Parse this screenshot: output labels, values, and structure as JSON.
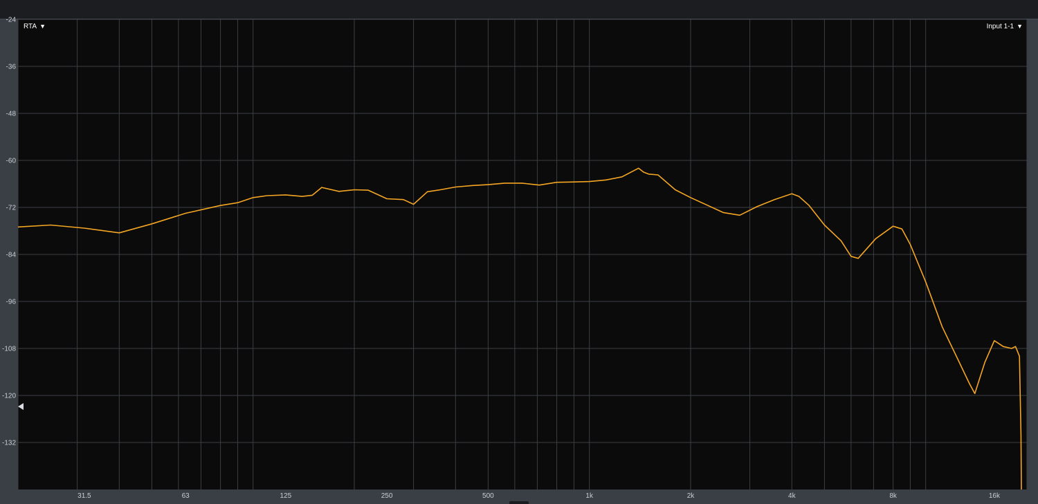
{
  "toolbar": {
    "analyzer_mode": "RTA",
    "input_source": "Input 1-1",
    "caret": "▼"
  },
  "icons": {
    "mode_dropdown": "chevron-down-icon",
    "input_dropdown": "chevron-down-icon",
    "floor_marker": "triangle-left-icon"
  },
  "colors": {
    "background": "#0b0b0b",
    "trace": "#f5a623",
    "grid": "#3b3f44",
    "chrome": "#3a3f45"
  },
  "chart_data": {
    "type": "line",
    "title": "",
    "xlabel": "",
    "ylabel": "",
    "x_scale": "log",
    "xlim": [
      20,
      20000
    ],
    "ylim": [
      -144,
      -24
    ],
    "grid": true,
    "y_ticks": [
      -24,
      -36,
      -48,
      -60,
      -72,
      -84,
      -96,
      -108,
      -120,
      -132
    ],
    "x_ticks": [
      {
        "label": "31.5",
        "value": 31.5
      },
      {
        "label": "63",
        "value": 63
      },
      {
        "label": "125",
        "value": 125
      },
      {
        "label": "250",
        "value": 250
      },
      {
        "label": "500",
        "value": 500
      },
      {
        "label": "1k",
        "value": 1000
      },
      {
        "label": "2k",
        "value": 2000
      },
      {
        "label": "4k",
        "value": 4000
      },
      {
        "label": "8k",
        "value": 8000
      },
      {
        "label": "16k",
        "value": 16000
      }
    ],
    "floor_marker_level": -120,
    "series": [
      {
        "x": [
          20,
          25,
          31.5,
          40,
          50,
          63,
          80,
          90,
          100,
          110,
          125,
          140,
          150,
          160,
          180,
          200,
          220,
          250,
          280,
          300,
          330,
          360,
          400,
          450,
          500,
          560,
          630,
          710,
          800,
          900,
          1000,
          1120,
          1250,
          1400,
          1450,
          1500,
          1600,
          1800,
          2000,
          2250,
          2500,
          2800,
          3150,
          3550,
          4000,
          4200,
          4500,
          5000,
          5600,
          6000,
          6300,
          7100,
          8000,
          8500,
          9000,
          10000,
          11200,
          12500,
          13500,
          14000,
          15000,
          16000,
          17000,
          18000,
          18500,
          19000,
          19200,
          19300
        ],
        "y": [
          -77,
          -76.5,
          -77.3,
          -78.5,
          -76.2,
          -73.5,
          -71.5,
          -70.8,
          -69.5,
          -69,
          -68.8,
          -69.2,
          -68.9,
          -66.9,
          -67.9,
          -67.5,
          -67.6,
          -69.8,
          -70,
          -71.2,
          -68,
          -67.5,
          -66.8,
          -66.4,
          -66.2,
          -65.8,
          -65.8,
          -66.3,
          -65.6,
          -65.5,
          -65.4,
          -65,
          -64.2,
          -62,
          -63,
          -63.5,
          -63.7,
          -67.5,
          -69.5,
          -71.5,
          -73.3,
          -74,
          -71.8,
          -70,
          -68.5,
          -69.2,
          -71.5,
          -76.5,
          -80.5,
          -84.5,
          -85,
          -80,
          -76.8,
          -77.5,
          -81.5,
          -91,
          -102.5,
          -111,
          -117,
          -119.5,
          -111.5,
          -106,
          -107.5,
          -108,
          -107.5,
          -110,
          -130,
          -144
        ]
      }
    ]
  }
}
